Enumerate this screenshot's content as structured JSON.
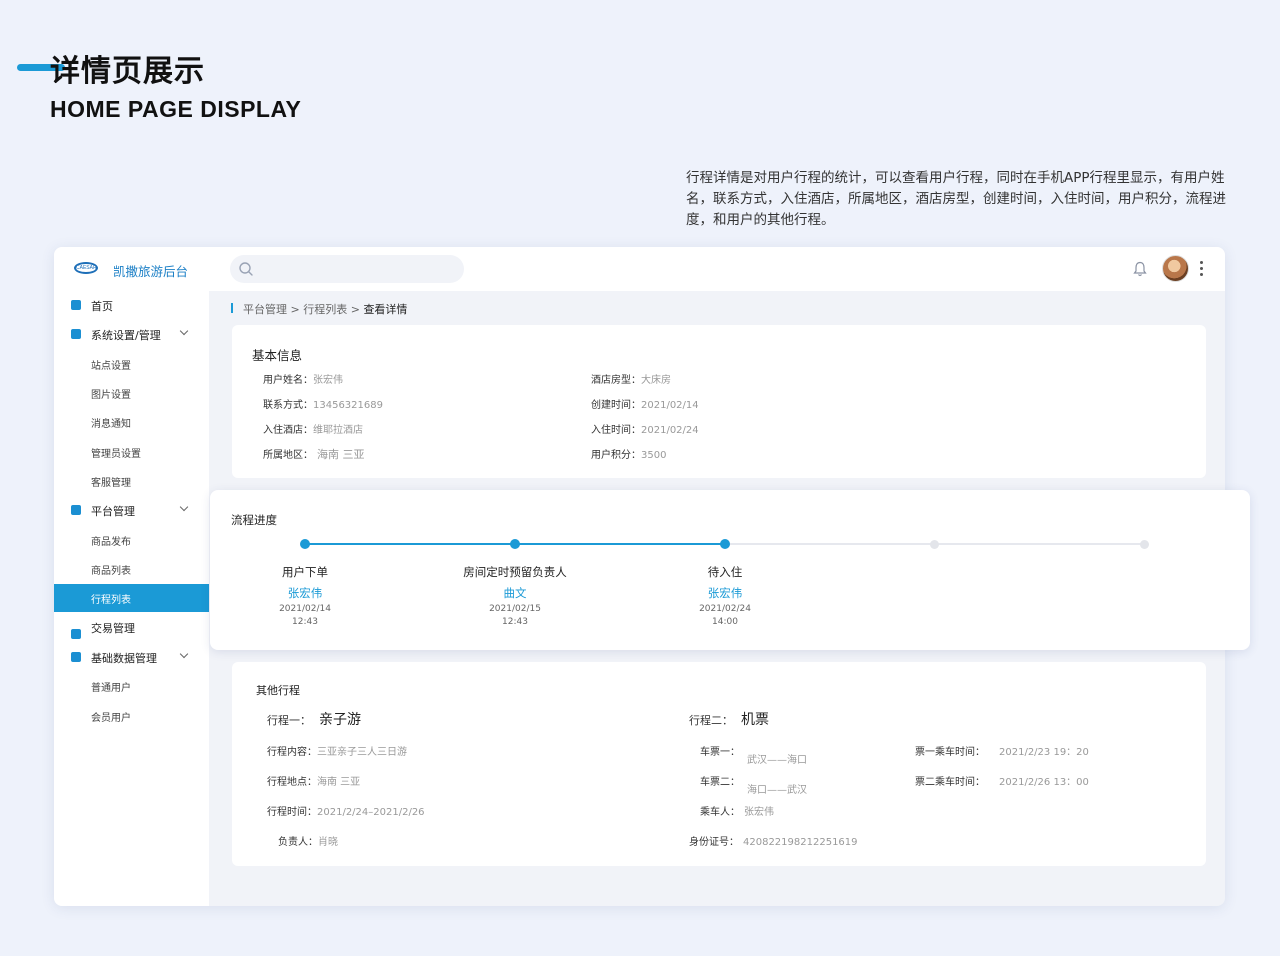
{
  "page": {
    "title": "详情页展示",
    "subtitle": "HOME PAGE DISPLAY",
    "description": "行程详情是对用户行程的统计，可以查看用户行程，同时在手机APP行程里显示，有用户姓名，联系方式，入住酒店，所属地区，酒店房型，创建时间，入住时间，用户积分，流程进度，和用户的其他行程。"
  },
  "app": {
    "logo_text": "CAESAR",
    "brand": "凯撒旅游后台",
    "search": {
      "placeholder": ""
    }
  },
  "sidebar": {
    "items": [
      {
        "label": "首页",
        "icon": "home-icon"
      },
      {
        "label": "系统设置/管理",
        "icon": "settings-icon",
        "expanded": true
      },
      {
        "label": "站点设置"
      },
      {
        "label": "图片设置"
      },
      {
        "label": "消息通知"
      },
      {
        "label": "管理员设置"
      },
      {
        "label": "客服管理"
      },
      {
        "label": "平台管理",
        "icon": "platform-icon",
        "expanded": true
      },
      {
        "label": "商品发布"
      },
      {
        "label": "商品列表"
      },
      {
        "label": "行程列表",
        "active": true
      },
      {
        "label": "交易管理",
        "icon": "trade-icon"
      },
      {
        "label": "基础数据管理",
        "icon": "data-icon",
        "expanded": true
      },
      {
        "label": "普通用户"
      },
      {
        "label": "会员用户"
      }
    ]
  },
  "breadcrumb": {
    "a": "平台管理",
    "b": "行程列表",
    "c": "查看详情",
    "sep": ">"
  },
  "basic": {
    "title": "基本信息",
    "name_k": "用户姓名：",
    "name_v": "张宏伟",
    "phone_k": "联系方式：",
    "phone_v": "13456321689",
    "hotel_k": "入住酒店：",
    "hotel_v": "维耶拉酒店",
    "region_k": "所属地区：",
    "region_v": "海南  三亚",
    "room_k": "酒店房型：",
    "room_v": "大床房",
    "created_k": "创建时间：",
    "created_v": "2021/02/14",
    "checkin_k": "入住时间：",
    "checkin_v": "2021/02/24",
    "points_k": "用户积分：",
    "points_v": "3500"
  },
  "progress": {
    "title": "流程进度",
    "accent": "#1b9ad6",
    "completed": 3,
    "total": 5,
    "steps": [
      {
        "title": "用户下单",
        "name": "张宏伟",
        "date": "2021/02/14",
        "time": "12:43"
      },
      {
        "title": "房间定时预留负责人",
        "name": "曲文",
        "date": "2021/02/15",
        "time": "12:43"
      },
      {
        "title": "待入住",
        "name": "张宏伟",
        "date": "2021/02/24",
        "time": "14:00"
      }
    ]
  },
  "other": {
    "title": "其他行程",
    "trip1_k": "行程一：",
    "trip1_v": "亲子游",
    "content_k": "行程内容：",
    "content_v": "三亚亲子三人三日游",
    "place_k": "行程地点：",
    "place_v": "海南  三亚",
    "time_k": "行程时间：",
    "time_v": "2021/2/24–2021/2/26",
    "owner_k": "负责人：",
    "owner_v": "肖晓",
    "trip2_k": "行程二：",
    "trip2_v": "机票",
    "t1_k": "车票一：",
    "t1_v": "武汉——海口",
    "t2_k": "车票二：",
    "t2_v": "海口——武汉",
    "pax_k": "乘车人：",
    "pax_v": "张宏伟",
    "id_k": "身份证号：",
    "id_v": "420822198212251619",
    "t1time_k": "票一乘车时间：",
    "t1time_v": "2021/2/23  19：20",
    "t2time_k": "票二乘车时间：",
    "t2time_v": "2021/2/26  13：00"
  }
}
